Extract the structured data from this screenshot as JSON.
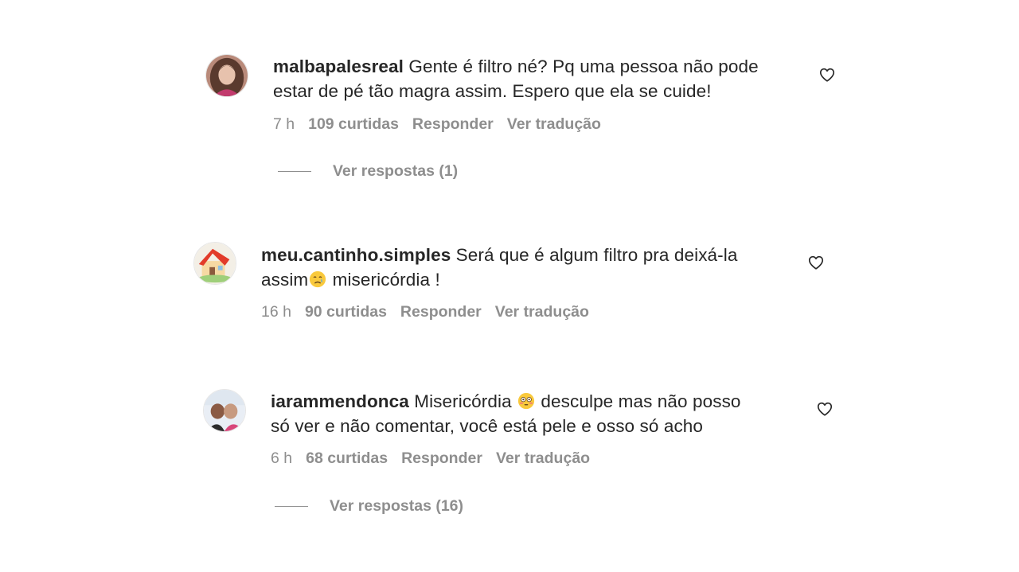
{
  "comments": [
    {
      "username": "malbapalesreal",
      "text_line1": "Gente é filtro né? Pq uma pessoa não pode",
      "text_line2": "estar de pé tão magra assim. Espero que ela se cuide!",
      "time": "7 h",
      "likes": "109 curtidas",
      "reply": "Responder",
      "translate": "Ver tradução",
      "view_replies": "Ver respostas (1)"
    },
    {
      "username": "meu.cantinho.simples",
      "text_line1": "Será que é algum filtro pra deixá-la",
      "text_line2_before": "assim",
      "emoji": "crying-face-emoji",
      "text_line2_after": " misericórdia !",
      "time": "16 h",
      "likes": "90 curtidas",
      "reply": "Responder",
      "translate": "Ver tradução"
    },
    {
      "username": "iarammendonca",
      "text_line1_before": "Misericórdia ",
      "emoji": "flushed-face-emoji",
      "text_line1_after": " desculpe mas não posso",
      "text_line2": "só ver e não comentar, você está pele e osso só acho",
      "time": "6 h",
      "likes": "68 curtidas",
      "reply": "Responder",
      "translate": "Ver tradução",
      "view_replies": "Ver respostas (16)"
    }
  ],
  "colors": {
    "text": "#262626",
    "secondary": "#8e8e8e"
  },
  "icons": {
    "like": "heart-outline-icon"
  }
}
